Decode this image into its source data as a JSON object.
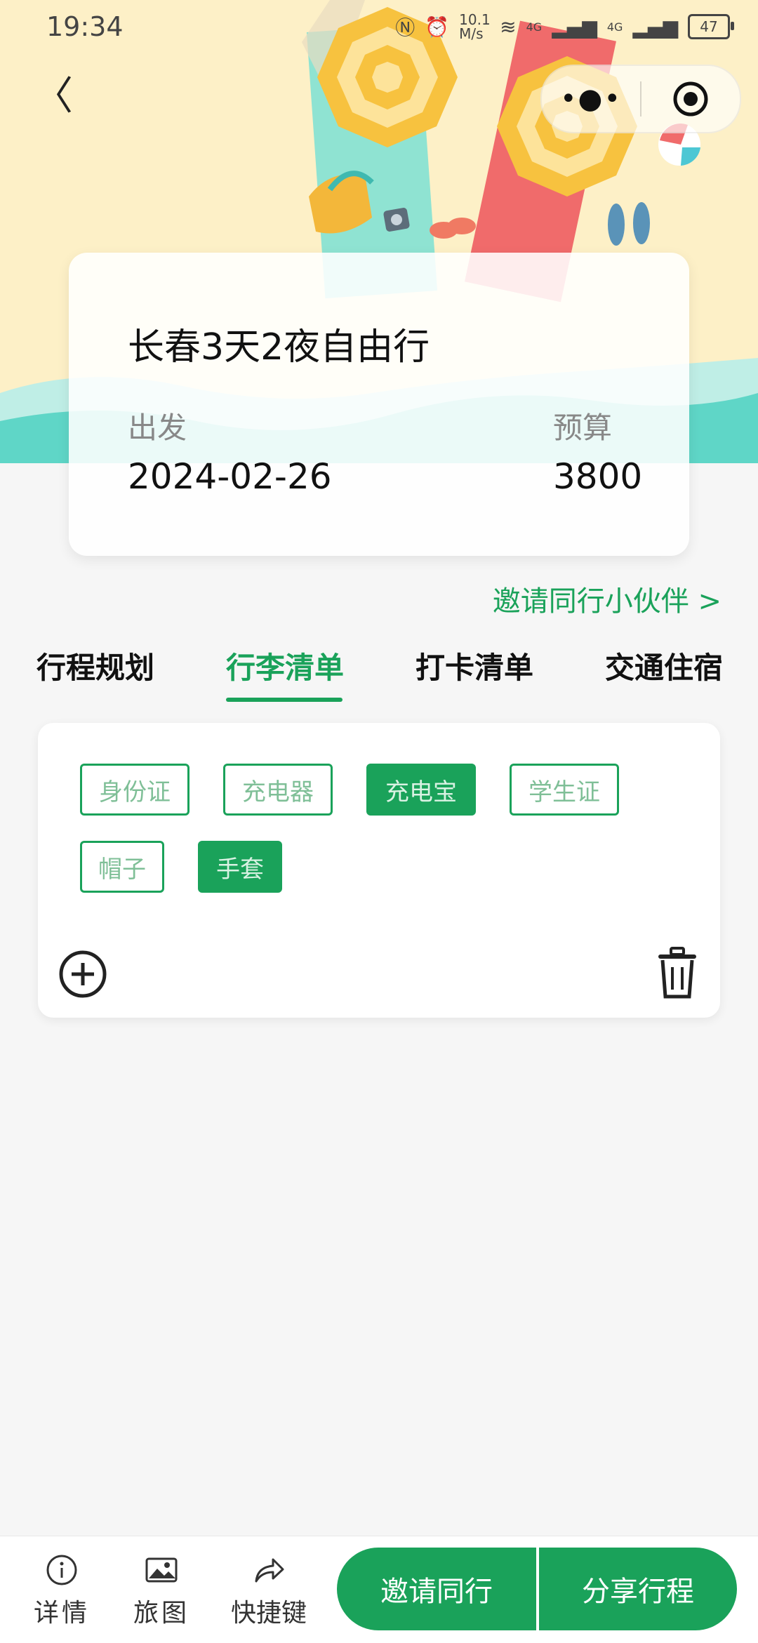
{
  "status": {
    "time": "19:34",
    "speed": "10.1 M/s",
    "battery": "47",
    "net1": "4G",
    "net2": "4G"
  },
  "trip": {
    "title": "长春3天2夜自由行",
    "depart_label": "出发",
    "depart_value": "2024-02-26",
    "budget_label": "预算",
    "budget_value": "3800"
  },
  "invite_link": "邀请同行小伙伴 >",
  "tabs": [
    {
      "label": "行程规划",
      "active": false
    },
    {
      "label": "行李清单",
      "active": true
    },
    {
      "label": "打卡清单",
      "active": false
    },
    {
      "label": "交通住宿",
      "active": false
    }
  ],
  "luggage": [
    {
      "label": "身份证",
      "checked": false
    },
    {
      "label": "充电器",
      "checked": false
    },
    {
      "label": "充电宝",
      "checked": true
    },
    {
      "label": "学生证",
      "checked": false
    },
    {
      "label": "帽子",
      "checked": false
    },
    {
      "label": "手套",
      "checked": true
    }
  ],
  "bottom": {
    "details_label": "详情",
    "map_label": "旅图",
    "shortcut_label": "快捷键",
    "invite_button": "邀请同行",
    "share_button": "分享行程"
  },
  "colors": {
    "accent": "#1aa25a",
    "hero_bg": "#fdf0c7",
    "sea": "#5fd6c7"
  }
}
